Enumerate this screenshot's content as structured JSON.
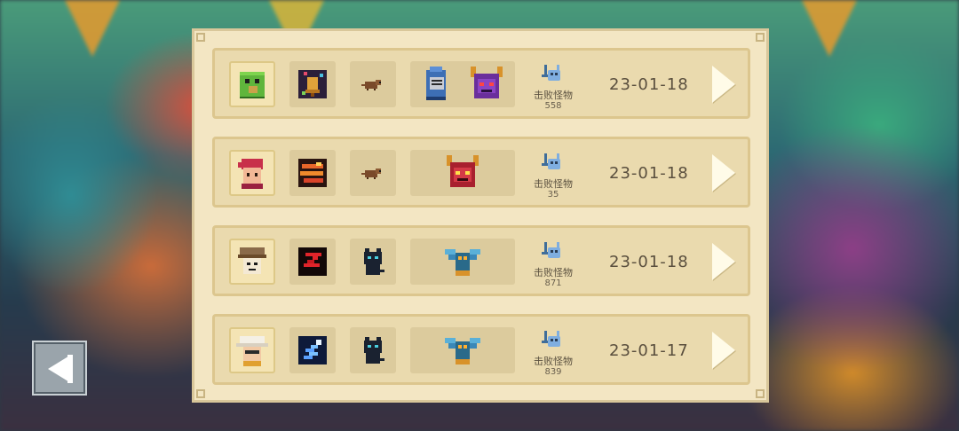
{
  "records": [
    {
      "hero": "green-dinosaur-hero-icon",
      "weapon": "bell-weapon-icon",
      "pet": "brown-rat-pet-icon",
      "bosses": [
        "blue-knight-helmet-boss-icon",
        "purple-horned-devil-boss-icon"
      ],
      "stat_label": "击败怪物",
      "kills": "558",
      "date": "23-01-18"
    },
    {
      "hero": "red-haired-hero-icon",
      "weapon": "fire-scroll-weapon-icon",
      "pet": "brown-rat-pet-icon",
      "bosses": [
        "red-horned-devil-boss-icon"
      ],
      "stat_label": "击败怪物",
      "kills": "35",
      "date": "23-01-18"
    },
    {
      "hero": "helmet-hero-icon",
      "weapon": "red-slash-weapon-icon",
      "pet": "black-cat-pet-icon",
      "bosses": [
        "blue-winged-boss-icon"
      ],
      "stat_label": "击败怪物",
      "kills": "871",
      "date": "23-01-18"
    },
    {
      "hero": "white-hat-hero-icon",
      "weapon": "lightning-weapon-icon",
      "pet": "black-cat-pet-icon",
      "bosses": [
        "blue-winged-boss-icon"
      ],
      "stat_label": "击败怪物",
      "kills": "839",
      "date": "23-01-17"
    }
  ],
  "colors": {
    "panel": "#f3e6c3",
    "row": "#eadaae",
    "slot": "#dccb9d",
    "text": "#5a4f3e",
    "arrow": "#fffbe8"
  }
}
